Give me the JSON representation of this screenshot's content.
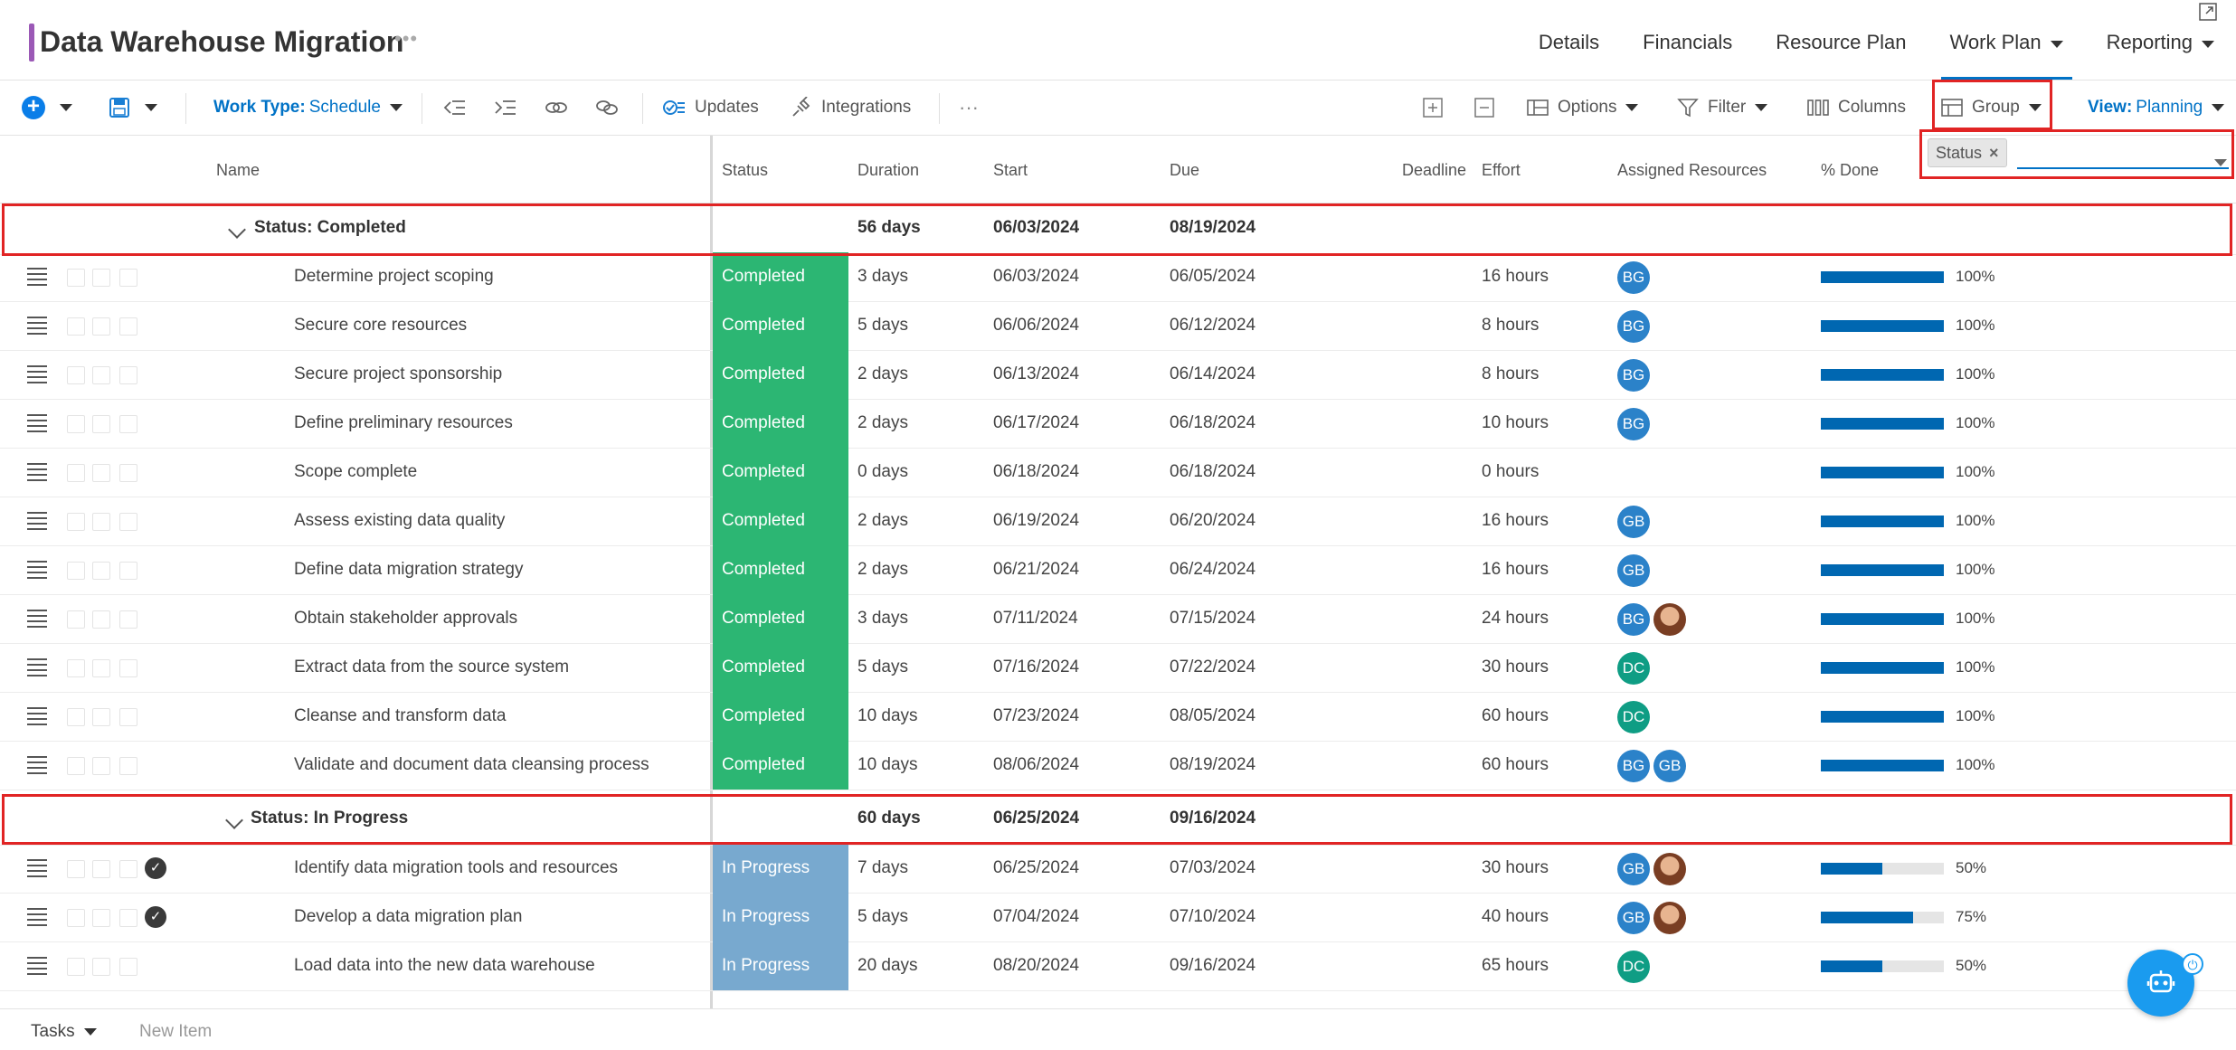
{
  "header": {
    "title": "Data Warehouse Migration",
    "more": "•••",
    "tabs": [
      {
        "label": "Details"
      },
      {
        "label": "Financials"
      },
      {
        "label": "Resource Plan"
      },
      {
        "label": "Work Plan"
      },
      {
        "label": "Reporting"
      }
    ],
    "active_tab": "Work Plan"
  },
  "toolbar": {
    "work_type_label": "Work Type:",
    "work_type_value": "Schedule",
    "updates": "Updates",
    "integrations": "Integrations",
    "more": "···",
    "options": "Options",
    "filter": "Filter",
    "columns": "Columns",
    "group": "Group",
    "view_label": "View:",
    "view_value": "Planning"
  },
  "group_by": {
    "chip": "Status",
    "remove": "×",
    "input_value": ""
  },
  "columns": {
    "name": "Name",
    "status": "Status",
    "duration": "Duration",
    "start": "Start",
    "due": "Due",
    "deadline": "Deadline",
    "effort": "Effort",
    "assigned": "Assigned Resources",
    "done": "% Done"
  },
  "groups": [
    {
      "label": "Status: Completed",
      "duration": "56 days",
      "start": "06/03/2024",
      "due": "08/19/2024"
    },
    {
      "label": "Status: In Progress",
      "duration": "60 days",
      "start": "06/25/2024",
      "due": "09/16/2024"
    }
  ],
  "tasks": [
    {
      "name": "Determine project scoping",
      "status": "Completed",
      "duration": "3 days",
      "start": "06/03/2024",
      "due": "06/05/2024",
      "effort": "16 hours",
      "resources": [
        "BG"
      ],
      "done": "100%",
      "pct": 100
    },
    {
      "name": "Secure core resources",
      "status": "Completed",
      "duration": "5 days",
      "start": "06/06/2024",
      "due": "06/12/2024",
      "effort": "8 hours",
      "resources": [
        "BG"
      ],
      "done": "100%",
      "pct": 100
    },
    {
      "name": "Secure project sponsorship",
      "status": "Completed",
      "duration": "2 days",
      "start": "06/13/2024",
      "due": "06/14/2024",
      "effort": "8 hours",
      "resources": [
        "BG"
      ],
      "done": "100%",
      "pct": 100
    },
    {
      "name": "Define preliminary resources",
      "status": "Completed",
      "duration": "2 days",
      "start": "06/17/2024",
      "due": "06/18/2024",
      "effort": "10 hours",
      "resources": [
        "BG"
      ],
      "done": "100%",
      "pct": 100
    },
    {
      "name": "Scope complete",
      "status": "Completed",
      "duration": "0 days",
      "start": "06/18/2024",
      "due": "06/18/2024",
      "effort": "0 hours",
      "resources": [],
      "done": "100%",
      "pct": 100
    },
    {
      "name": "Assess existing data quality",
      "status": "Completed",
      "duration": "2 days",
      "start": "06/19/2024",
      "due": "06/20/2024",
      "effort": "16 hours",
      "resources": [
        "GB"
      ],
      "done": "100%",
      "pct": 100
    },
    {
      "name": "Define data migration strategy",
      "status": "Completed",
      "duration": "2 days",
      "start": "06/21/2024",
      "due": "06/24/2024",
      "effort": "16 hours",
      "resources": [
        "GB"
      ],
      "done": "100%",
      "pct": 100
    },
    {
      "name": "Obtain stakeholder approvals",
      "status": "Completed",
      "duration": "3 days",
      "start": "07/11/2024",
      "due": "07/15/2024",
      "effort": "24 hours",
      "resources": [
        "BG",
        "photo"
      ],
      "done": "100%",
      "pct": 100
    },
    {
      "name": "Extract data from the source system",
      "status": "Completed",
      "duration": "5 days",
      "start": "07/16/2024",
      "due": "07/22/2024",
      "effort": "30 hours",
      "resources": [
        "DC"
      ],
      "done": "100%",
      "pct": 100
    },
    {
      "name": "Cleanse and transform data",
      "status": "Completed",
      "duration": "10 days",
      "start": "07/23/2024",
      "due": "08/05/2024",
      "effort": "60 hours",
      "resources": [
        "DC"
      ],
      "done": "100%",
      "pct": 100
    },
    {
      "name": "Validate and document data cleansing process",
      "status": "Completed",
      "duration": "10 days",
      "start": "08/06/2024",
      "due": "08/19/2024",
      "effort": "60 hours",
      "resources": [
        "BG",
        "GB"
      ],
      "done": "100%",
      "pct": 100
    },
    {
      "name": "Identify data migration tools and resources",
      "status": "In Progress",
      "duration": "7 days",
      "start": "06/25/2024",
      "due": "07/03/2024",
      "effort": "30 hours",
      "resources": [
        "GB",
        "photo"
      ],
      "done": "50%",
      "pct": 50,
      "checked": true
    },
    {
      "name": "Develop a data migration plan",
      "status": "In Progress",
      "duration": "5 days",
      "start": "07/04/2024",
      "due": "07/10/2024",
      "effort": "40 hours",
      "resources": [
        "GB",
        "photo"
      ],
      "done": "75%",
      "pct": 75,
      "checked": true
    },
    {
      "name": "Load data into the new data warehouse",
      "status": "In Progress",
      "duration": "20 days",
      "start": "08/20/2024",
      "due": "09/16/2024",
      "effort": "65 hours",
      "resources": [
        "DC"
      ],
      "done": "50%",
      "pct": 50
    }
  ],
  "footer": {
    "tasks_label": "Tasks",
    "new_item": "New Item"
  },
  "colors": {
    "completed": "#2cb673",
    "in_progress": "#78a9cf",
    "accent": "#0072c6",
    "title_accent": "#9b59b6"
  }
}
